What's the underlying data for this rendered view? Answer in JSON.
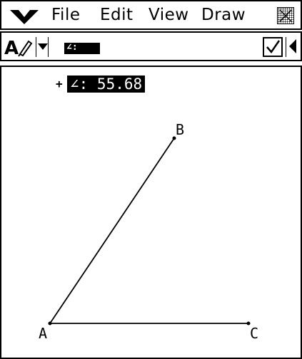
{
  "menubar": {
    "logo_icon": "casio-menu-chevron-icon",
    "items": [
      "File",
      "Edit",
      "View",
      "Draw"
    ],
    "close_icon": "close-icon"
  },
  "toolbar": {
    "draw_tool_icon": "font-pen-icon",
    "dropdown_icon": "triangle-down-icon",
    "measurement_label": "∠:",
    "check_icon": "checkbox-checked-icon",
    "scroll_icon": "triangle-left-icon"
  },
  "canvas": {
    "angle_readout": {
      "marker": "+",
      "text": "∠: 55.68"
    },
    "points": [
      {
        "name": "A"
      },
      {
        "name": "B"
      },
      {
        "name": "C"
      }
    ],
    "segments": [
      [
        "A",
        "B"
      ],
      [
        "A",
        "C"
      ]
    ]
  }
}
